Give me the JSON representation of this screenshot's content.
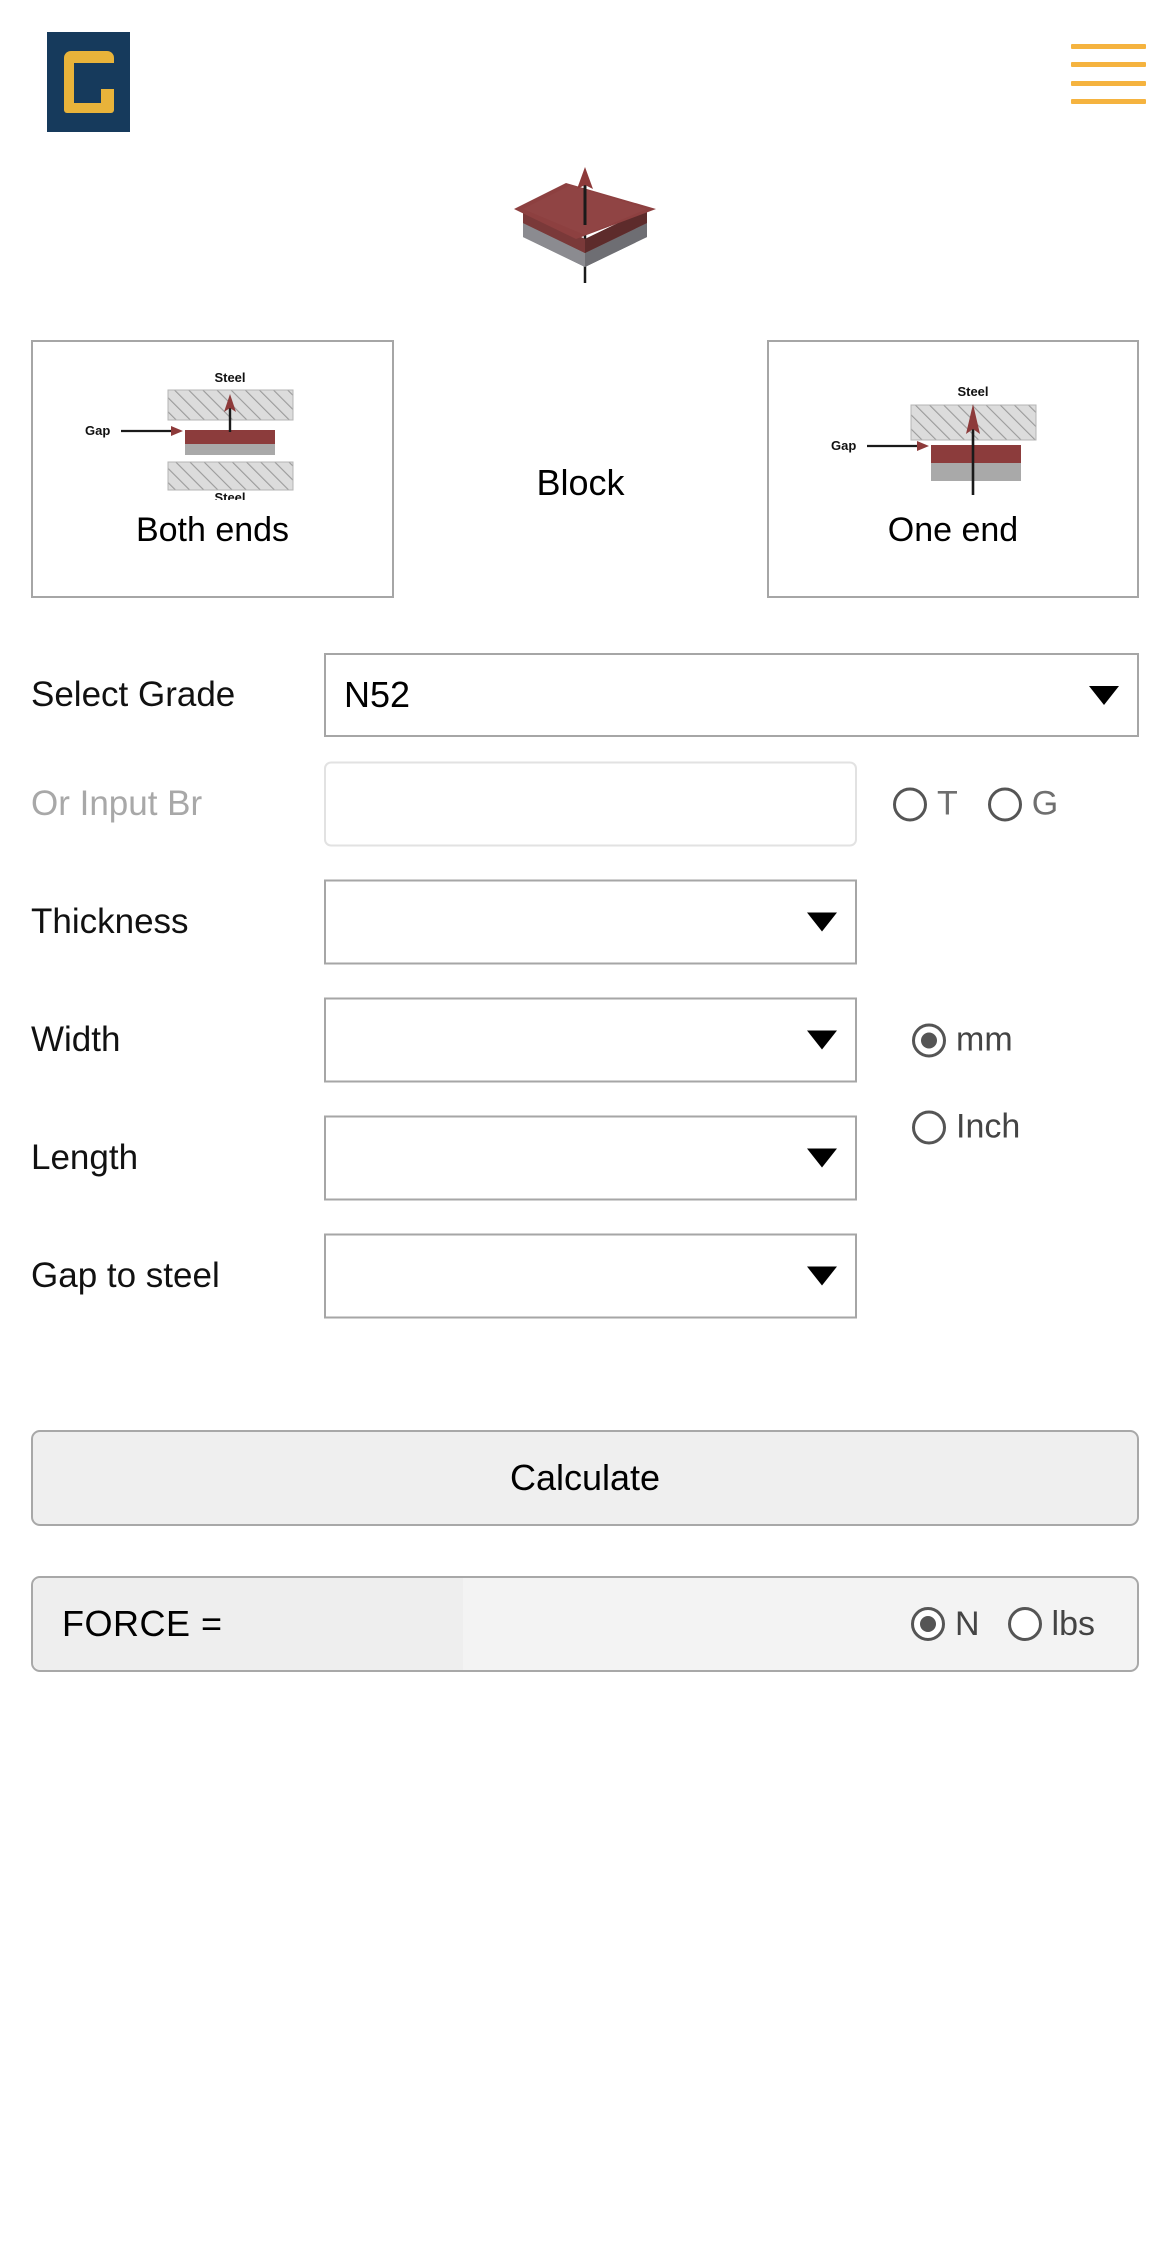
{
  "header": {
    "logo_name": "company-logo",
    "logo_bg": "#163a5c",
    "logo_fg": "#e8b33a",
    "menu_color": "#f5b33f",
    "menu_bars": 4
  },
  "hero": {
    "shape": "block-magnet-3d",
    "magnet_top_color": "#8d4040",
    "magnet_side_color": "#6e3333",
    "magnet_base_color": "#7d7d82",
    "arrow_color": "#8d3a3a"
  },
  "type_selector": {
    "left": {
      "label": "Both ends",
      "diagram": {
        "steel_top_label": "Steel",
        "steel_bottom_label": "Steel",
        "gap_label": "Gap"
      }
    },
    "center": {
      "label": "Block"
    },
    "right": {
      "label": "One end",
      "diagram": {
        "steel_top_label": "Steel",
        "gap_label": "Gap"
      }
    }
  },
  "form": {
    "rows": [
      {
        "label": "Select Grade",
        "value": "N52",
        "placeholder": "",
        "control": "select"
      },
      {
        "label": "Or Input Br",
        "value": "",
        "placeholder": "",
        "control": "text"
      },
      {
        "label": "Thickness",
        "value": "",
        "placeholder": "",
        "control": "select"
      },
      {
        "label": "Width",
        "value": "",
        "placeholder": "",
        "control": "select"
      },
      {
        "label": "Length",
        "value": "",
        "placeholder": "",
        "control": "select"
      },
      {
        "label": "Gap to steel",
        "value": "",
        "placeholder": "",
        "control": "select"
      }
    ],
    "br_units": [
      {
        "label": "T",
        "selected": false
      },
      {
        "label": "G",
        "selected": false
      }
    ],
    "dimension_units": [
      {
        "label": "mm",
        "selected": true
      },
      {
        "label": "Inch",
        "selected": false
      }
    ]
  },
  "actions": {
    "calculate_label": "Calculate"
  },
  "result": {
    "label": "FORCE =",
    "value": "",
    "units": [
      {
        "label": "N",
        "selected": true
      },
      {
        "label": "lbs",
        "selected": false
      }
    ]
  }
}
